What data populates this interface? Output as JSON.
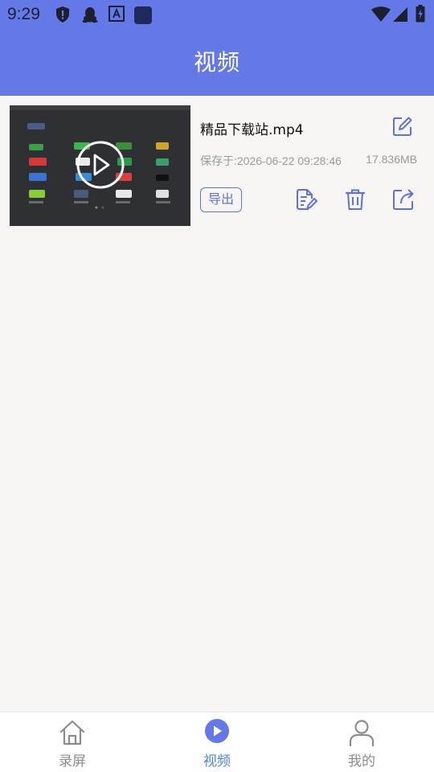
{
  "status_bar": {
    "time": "9:29",
    "left_icons": [
      "shield-icon",
      "qq-icon",
      "font-a-icon",
      "app-square-icon"
    ],
    "right_icons": [
      "wifi-icon",
      "cellular-signal-icon",
      "battery-charging-icon"
    ]
  },
  "header": {
    "title": "视频"
  },
  "videos": [
    {
      "file_name": "精品下载站.mp4",
      "saved_at": "保存于:2026-06-22 09:28:46",
      "size": "17.836MB",
      "export_label": "导出",
      "icons": [
        "edit-name-icon",
        "play-icon",
        "edit-document-icon",
        "trash-icon",
        "share-icon"
      ]
    }
  ],
  "bottom_nav": {
    "items": [
      {
        "label": "录屏",
        "icon": "home-icon",
        "active": false
      },
      {
        "label": "视频",
        "icon": "play-circle-icon",
        "active": true
      },
      {
        "label": "我的",
        "icon": "person-icon",
        "active": false
      }
    ]
  },
  "colors": {
    "header_blue": "#6478e8",
    "accent_blue": "#5d72e0",
    "active_tab": "#4b84e8",
    "background": "#f6f5f4"
  }
}
